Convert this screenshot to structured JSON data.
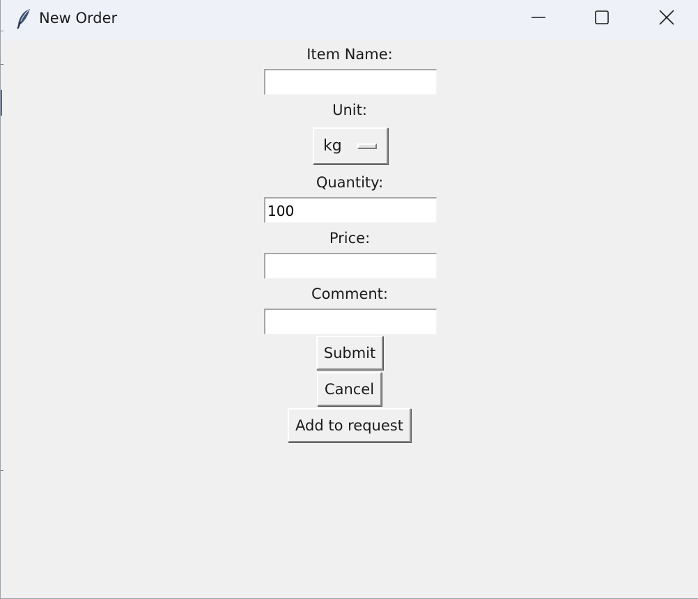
{
  "window": {
    "title": "New Order",
    "icon": "feather-icon",
    "controls": {
      "minimize": "minimize-icon",
      "maximize": "maximize-icon",
      "close": "close-icon"
    }
  },
  "form": {
    "item_name": {
      "label": "Item Name:",
      "value": ""
    },
    "unit": {
      "label": "Unit:",
      "selected": "kg"
    },
    "quantity": {
      "label": "Quantity:",
      "value": "100"
    },
    "price": {
      "label": "Price:",
      "value": ""
    },
    "comment": {
      "label": "Comment:",
      "value": ""
    }
  },
  "buttons": {
    "submit": "Submit",
    "cancel": "Cancel",
    "add_to_request": "Add to request"
  },
  "colors": {
    "window_bg": "#f0f0f0",
    "titlebar_bg": "#eef1f8"
  }
}
